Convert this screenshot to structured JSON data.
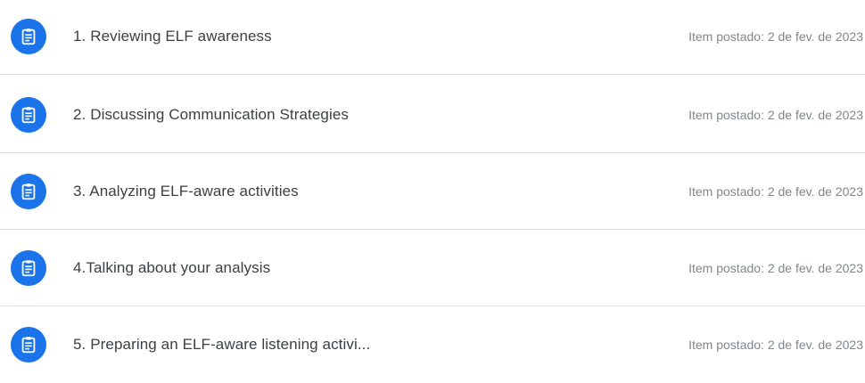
{
  "assignments": [
    {
      "icon": "assignment-icon",
      "title": "1. Reviewing ELF awareness",
      "posted": "Item postado: 2 de fev. de 2023"
    },
    {
      "icon": "assignment-icon",
      "title": "2. Discussing Communication Strategies",
      "posted": "Item postado: 2 de fev. de 2023"
    },
    {
      "icon": "assignment-icon",
      "title": "3. Analyzing ELF-aware activities",
      "posted": "Item postado: 2 de fev. de 2023"
    },
    {
      "icon": "assignment-icon",
      "title": "4.Talking about your analysis",
      "posted": "Item postado: 2 de fev. de 2023"
    },
    {
      "icon": "assignment-icon",
      "title": "5. Preparing an ELF-aware listening activi...",
      "posted": "Item postado: 2 de fev. de 2023"
    }
  ],
  "colors": {
    "icon_bg": "#1a73e8",
    "title_text": "#3c4043",
    "date_text": "#80868b",
    "divider": "#dadce0"
  }
}
